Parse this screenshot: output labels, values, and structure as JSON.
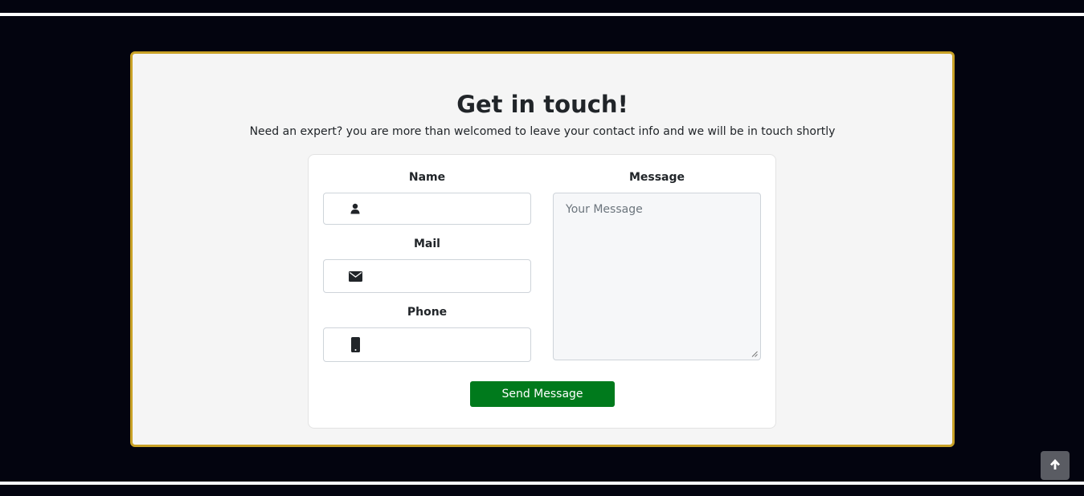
{
  "contact": {
    "title": "Get in touch!",
    "subtitle": "Need an expert? you are more than welcomed to leave your contact info and we will be in touch shortly"
  },
  "form": {
    "name_label": "Name",
    "name_value": "",
    "name_icon": "user-icon",
    "mail_label": "Mail",
    "mail_value": "",
    "mail_icon": "envelope-icon",
    "phone_label": "Phone",
    "phone_value": "",
    "phone_icon": "mobile-phone-icon",
    "message_label": "Message",
    "message_placeholder": "Your Message",
    "message_value": "",
    "submit_label": "Send Message"
  },
  "scroll_top": {
    "icon": "arrow-up-icon"
  },
  "colors": {
    "page_background": "#03040f",
    "panel_background": "#f5f5f5",
    "panel_border": "#c9a227",
    "submit_button": "#007a1c",
    "scroll_top_button": "#5a5c63"
  }
}
